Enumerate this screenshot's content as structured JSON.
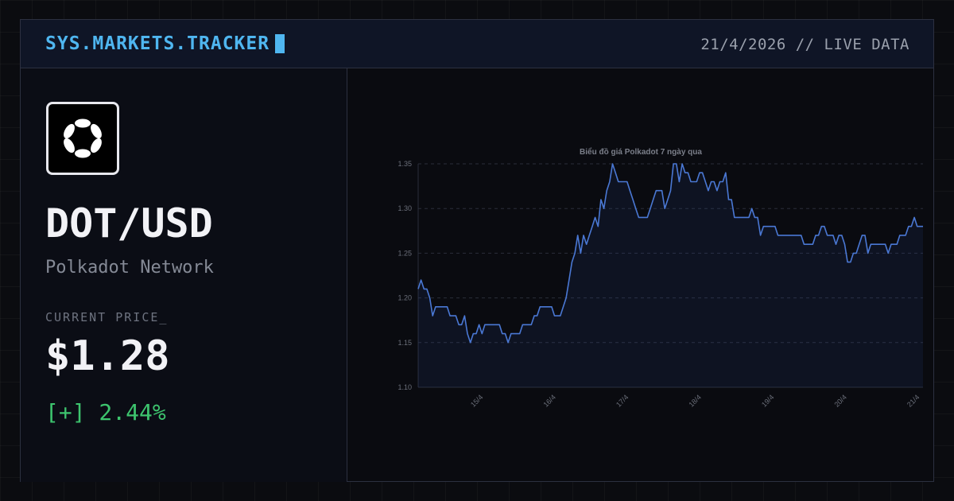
{
  "header": {
    "brand": "SYS.MARKETS.TRACKER",
    "status": "21/4/2026 // LIVE DATA"
  },
  "asset": {
    "logo_icon": "polkadot-logo-icon",
    "pair": "DOT/USD",
    "network": "Polkadot Network",
    "price_label": "CURRENT PRICE_",
    "price": "$1.28",
    "change": "[+] 2.44%"
  },
  "colors": {
    "accent": "#4fb6f0",
    "positive": "#3dc46e",
    "line": "#4a78d4"
  },
  "chart_data": {
    "type": "area",
    "title": "Biểu đồ giá Polkadot 7 ngày qua",
    "xlabel": "",
    "ylabel": "",
    "ylim": [
      1.1,
      1.35
    ],
    "yticks": [
      "1.35",
      "1.30",
      "1.25",
      "1.20",
      "1.15",
      "1.10"
    ],
    "xticks": [
      "15/4",
      "16/4",
      "17/4",
      "18/4",
      "19/4",
      "20/4",
      "21/4"
    ],
    "grid": "horizontal dashed",
    "series": [
      {
        "name": "",
        "values": [
          1.21,
          1.22,
          1.21,
          1.21,
          1.2,
          1.18,
          1.19,
          1.19,
          1.19,
          1.19,
          1.19,
          1.18,
          1.18,
          1.18,
          1.17,
          1.17,
          1.18,
          1.16,
          1.15,
          1.16,
          1.16,
          1.17,
          1.16,
          1.17,
          1.17,
          1.17,
          1.17,
          1.17,
          1.17,
          1.16,
          1.16,
          1.15,
          1.16,
          1.16,
          1.16,
          1.16,
          1.17,
          1.17,
          1.17,
          1.17,
          1.18,
          1.18,
          1.19,
          1.19,
          1.19,
          1.19,
          1.19,
          1.18,
          1.18,
          1.18,
          1.19,
          1.2,
          1.22,
          1.24,
          1.25,
          1.27,
          1.25,
          1.27,
          1.26,
          1.27,
          1.28,
          1.29,
          1.28,
          1.31,
          1.3,
          1.32,
          1.33,
          1.35,
          1.34,
          1.33,
          1.33,
          1.33,
          1.33,
          1.32,
          1.31,
          1.3,
          1.29,
          1.29,
          1.29,
          1.29,
          1.3,
          1.31,
          1.32,
          1.32,
          1.32,
          1.3,
          1.31,
          1.32,
          1.35,
          1.35,
          1.33,
          1.35,
          1.34,
          1.34,
          1.33,
          1.33,
          1.33,
          1.34,
          1.34,
          1.33,
          1.32,
          1.33,
          1.33,
          1.32,
          1.33,
          1.33,
          1.34,
          1.31,
          1.31,
          1.29,
          1.29,
          1.29,
          1.29,
          1.29,
          1.29,
          1.3,
          1.29,
          1.29,
          1.27,
          1.28,
          1.28,
          1.28,
          1.28,
          1.28,
          1.27,
          1.27,
          1.27,
          1.27,
          1.27,
          1.27,
          1.27,
          1.27,
          1.27,
          1.26,
          1.26,
          1.26,
          1.26,
          1.27,
          1.27,
          1.28,
          1.28,
          1.27,
          1.27,
          1.27,
          1.26,
          1.27,
          1.27,
          1.26,
          1.24,
          1.24,
          1.25,
          1.25,
          1.26,
          1.27,
          1.27,
          1.25,
          1.26,
          1.26,
          1.26,
          1.26,
          1.26,
          1.26,
          1.25,
          1.26,
          1.26,
          1.26,
          1.27,
          1.27,
          1.27,
          1.28,
          1.28,
          1.29,
          1.28,
          1.28,
          1.28
        ]
      }
    ]
  }
}
